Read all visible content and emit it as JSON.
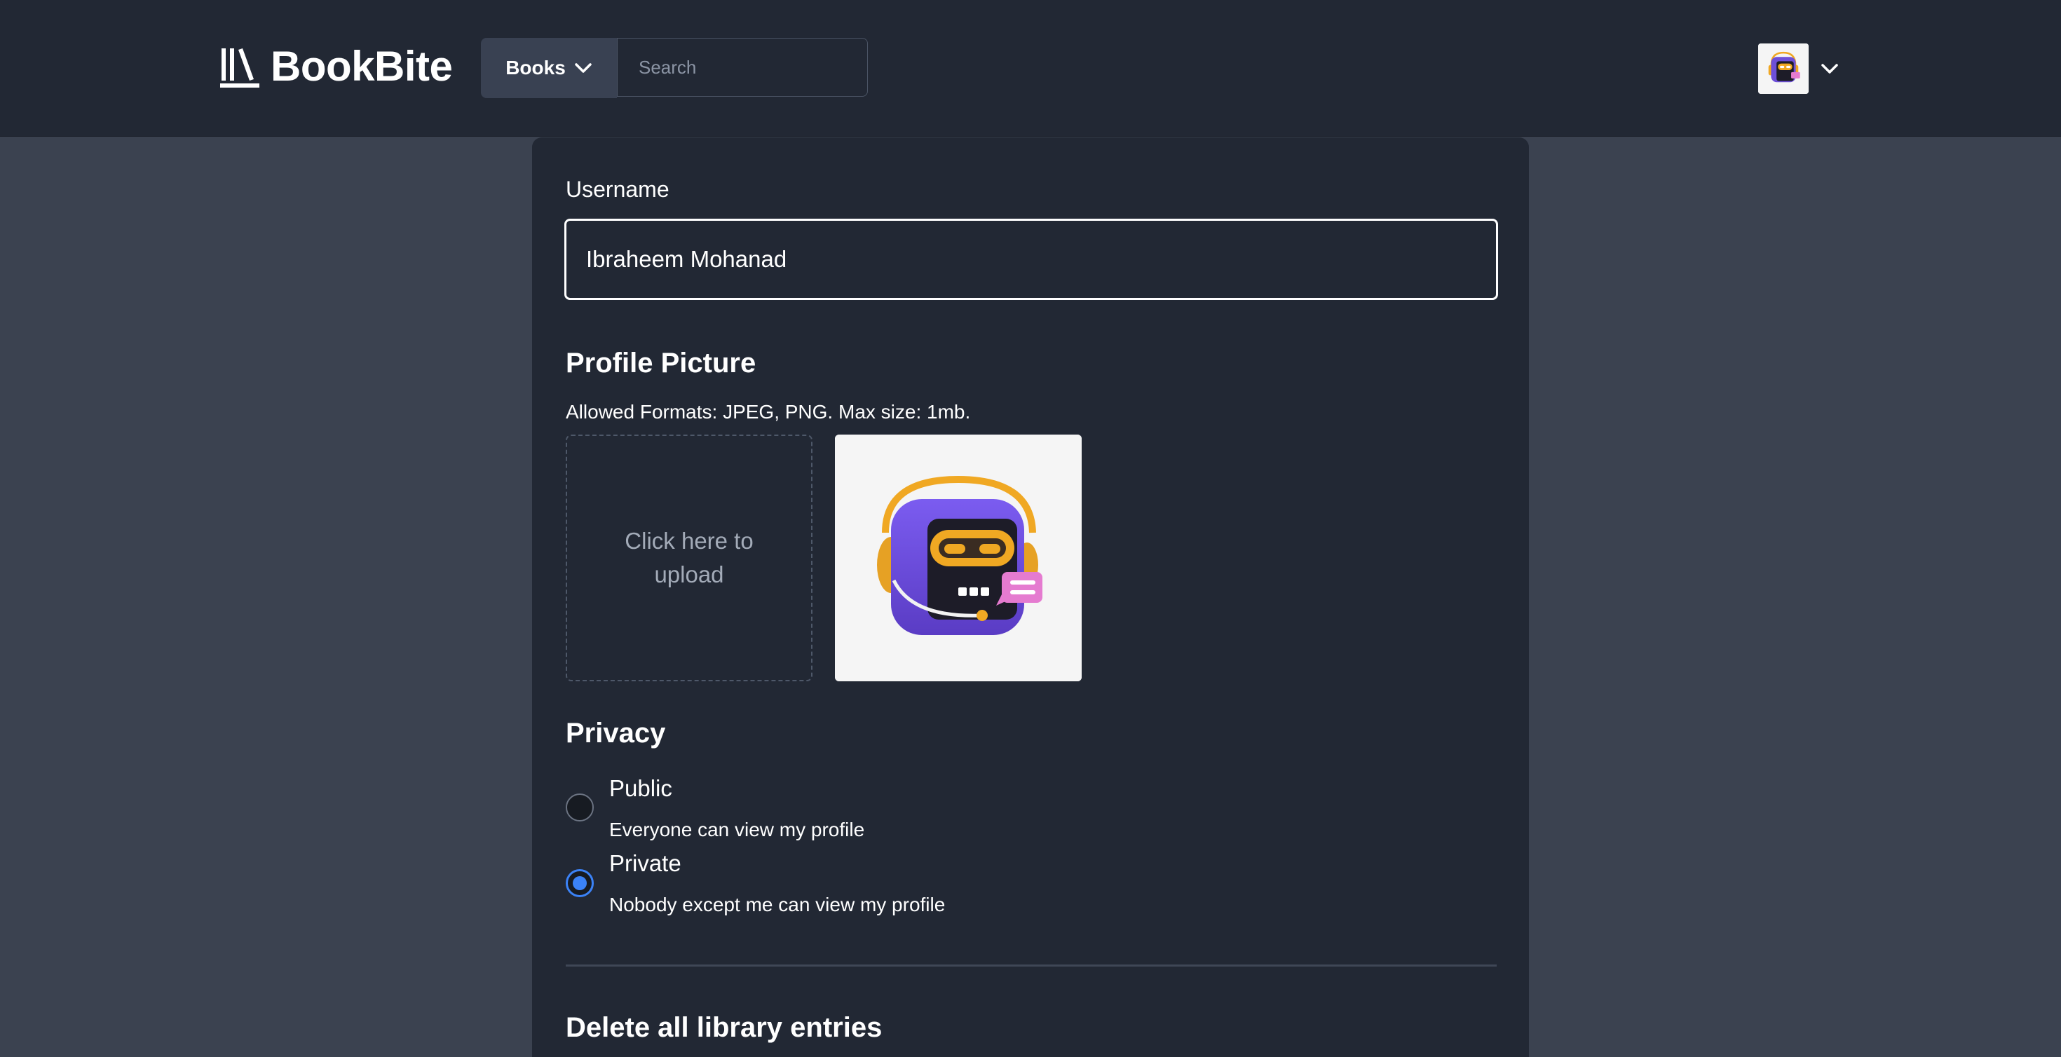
{
  "header": {
    "logo_text": "BookBite",
    "books_label": "Books",
    "search_placeholder": "Search"
  },
  "profile_form": {
    "username_label": "Username",
    "username_value": "Ibraheem Mohanad",
    "picture_title": "Profile Picture",
    "allowed_formats": "Allowed Formats: JPEG, PNG. Max size: 1mb.",
    "upload_text": "Click here to upload",
    "privacy_title": "Privacy",
    "privacy_options": [
      {
        "label": "Public",
        "description": "Everyone can view my profile",
        "selected": false
      },
      {
        "label": "Private",
        "description": "Nobody except me can view my profile",
        "selected": true
      }
    ],
    "delete_title": "Delete all library entries"
  },
  "colors": {
    "header_bg": "#222834",
    "page_bg": "#3b4250",
    "card_bg": "#222834",
    "accent": "#3b82f6",
    "avatar_purple": "#6d4fd8",
    "avatar_orange": "#f0a823",
    "bubble_pink": "#e57bd0"
  },
  "icons": {
    "logo": "library-books-icon",
    "books_dropdown": "chevron-down-icon",
    "user_menu": "chevron-down-icon",
    "avatar": "robot-headset-avatar"
  }
}
